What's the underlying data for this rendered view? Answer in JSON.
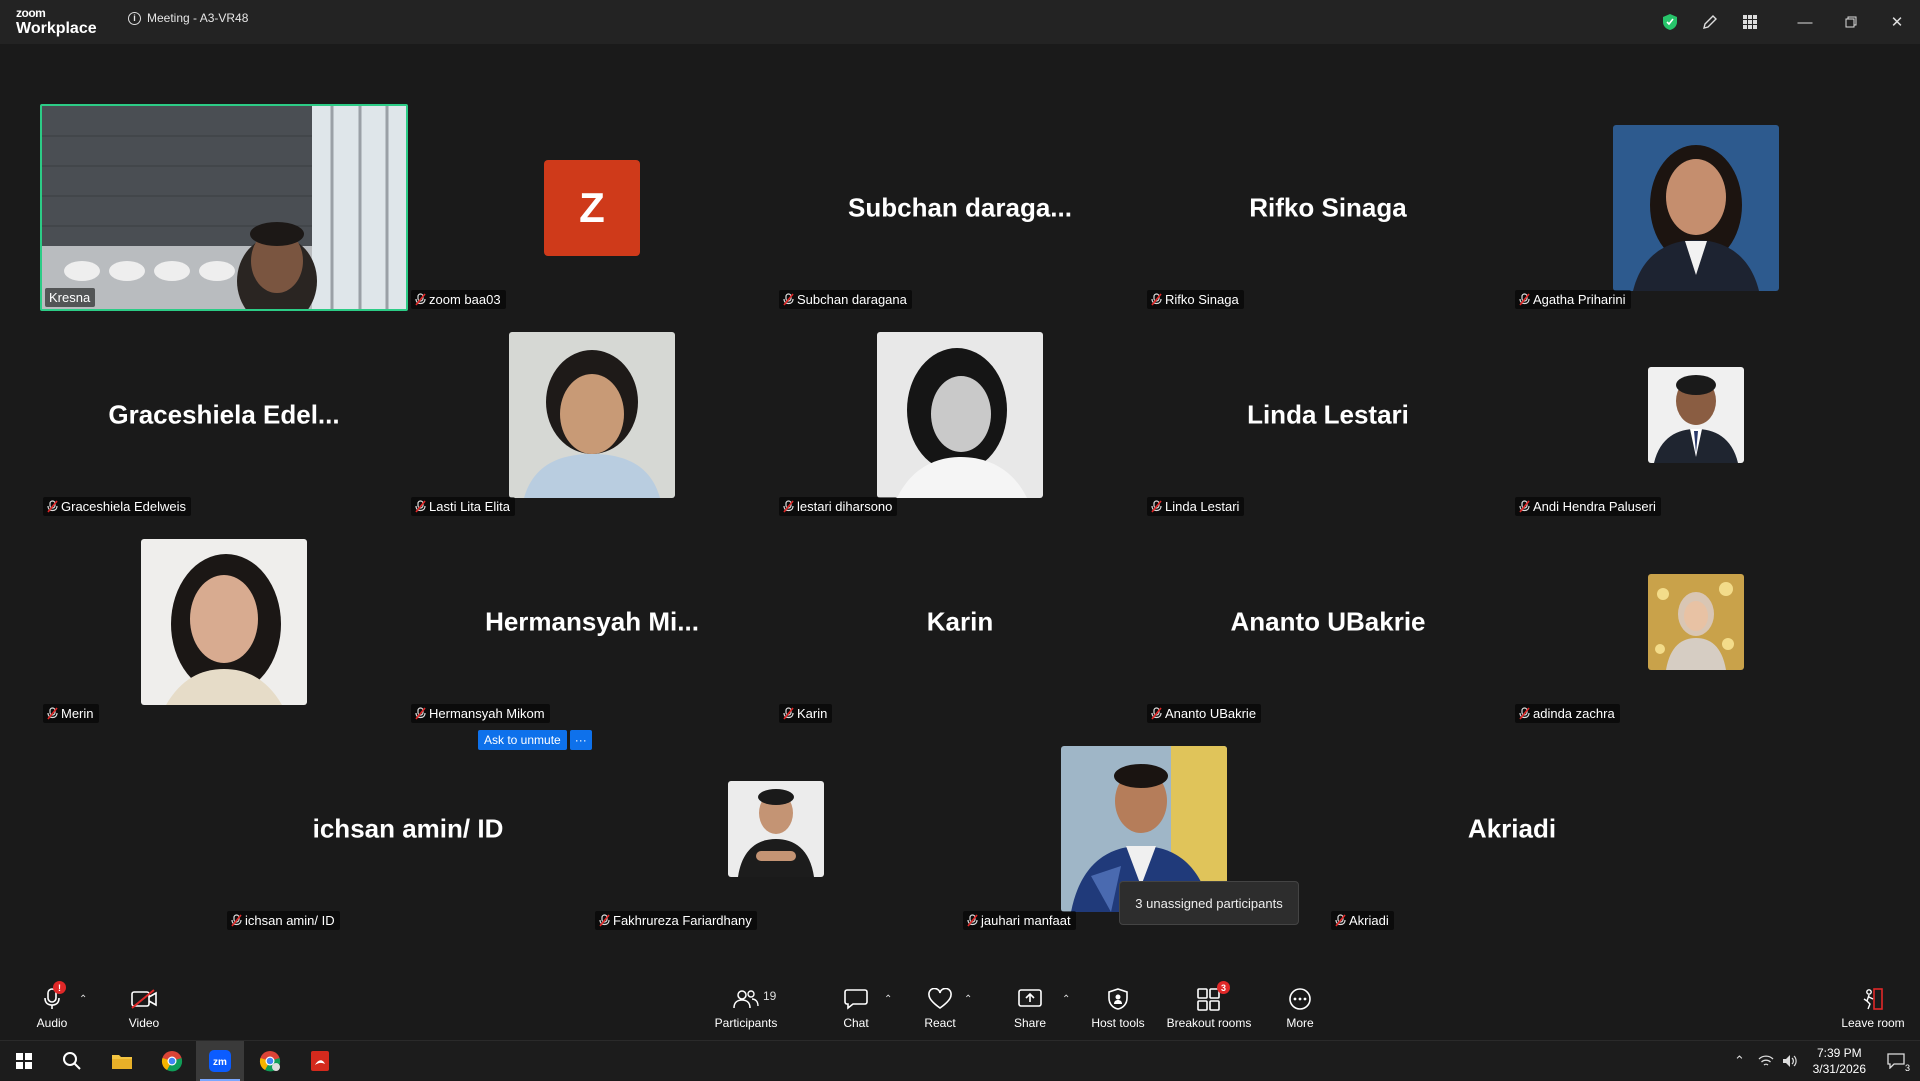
{
  "app": {
    "brand_top": "zoom",
    "brand_bottom": "Workplace",
    "meeting_title": "Meeting - A3-VR48"
  },
  "tiles": [
    {
      "label": "Kresna",
      "big": "",
      "avatar": "video"
    },
    {
      "label": "zoom baa03",
      "big": "",
      "avatar": "letter",
      "letter": "Z"
    },
    {
      "label": "Subchan daragana",
      "big": "Subchan  daraga..."
    },
    {
      "label": "Rifko Sinaga",
      "big": "Rifko Sinaga"
    },
    {
      "label": "Agatha Priharini",
      "big": "",
      "avatar": "photo"
    },
    {
      "label": "Graceshiela Edelweis",
      "big": "Graceshiela  Edel..."
    },
    {
      "label": "Lasti Lita Elita",
      "big": "",
      "avatar": "photo"
    },
    {
      "label": "lestari diharsono",
      "big": "",
      "avatar": "photo"
    },
    {
      "label": "Linda Lestari",
      "big": "Linda Lestari"
    },
    {
      "label": "Andi Hendra Paluseri",
      "big": "",
      "avatar": "photo"
    },
    {
      "label": "Merin",
      "big": "",
      "avatar": "photo"
    },
    {
      "label": "Hermansyah Mikom",
      "big": "Hermansyah  Mi..."
    },
    {
      "label": "Karin",
      "big": "Karin"
    },
    {
      "label": "Ananto UBakrie",
      "big": "Ananto UBakrie"
    },
    {
      "label": "adinda zachra",
      "big": "",
      "avatar": "photo"
    },
    {
      "label": "ichsan amin/ ID",
      "big": "ichsan amin/ ID"
    },
    {
      "label": "Fakhrureza Fariardhany",
      "big": "",
      "avatar": "photo"
    },
    {
      "label": "jauhari manfaat",
      "big": "",
      "avatar": "photo"
    },
    {
      "label": "Akriadi",
      "big": "Akriadi"
    }
  ],
  "hover": {
    "ask_unmute": "Ask to unmute",
    "more": "···"
  },
  "tooltip": "3 unassigned participants",
  "toolbar": {
    "audio": "Audio",
    "video": "Video",
    "participants": "Participants",
    "participants_count": "19",
    "chat": "Chat",
    "react": "React",
    "share": "Share",
    "host_tools": "Host tools",
    "breakout_rooms": "Breakout rooms",
    "breakout_badge": "3",
    "more": "More",
    "leave": "Leave room"
  },
  "taskbar": {
    "time": "7:39 PM",
    "date": "3/31/2026",
    "notif_count": "3"
  },
  "colors": {
    "active_border": "#2ccc86",
    "accent_blue": "#0e71eb",
    "muted_red": "#e02828",
    "z_avatar": "#cf3a1a"
  }
}
